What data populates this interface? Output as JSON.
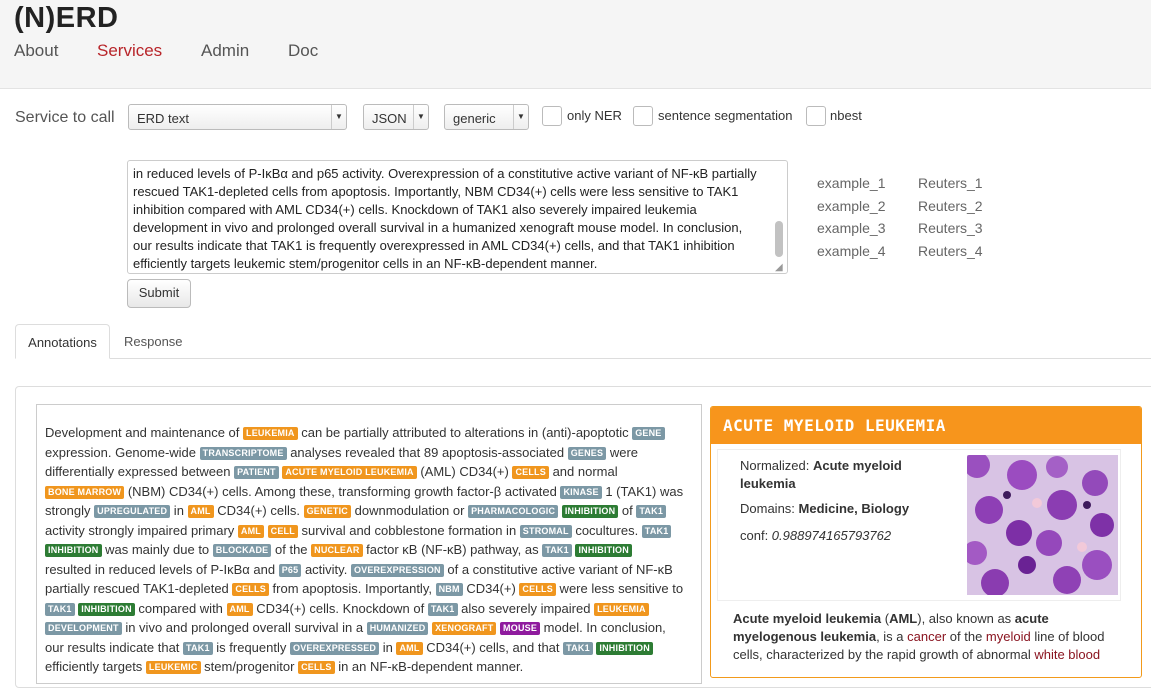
{
  "app": {
    "brand": "(N)ERD"
  },
  "nav": {
    "items": [
      {
        "label": "About"
      },
      {
        "label": "Services",
        "active": true
      },
      {
        "label": "Admin"
      },
      {
        "label": "Doc"
      }
    ]
  },
  "form": {
    "service_label": "Service to call",
    "service_value": "ERD text",
    "format_value": "JSON",
    "customisation_value": "generic",
    "checkboxes": {
      "only_ner": "only NER",
      "sentence_segmentation": "sentence segmentation",
      "nbest": "nbest"
    },
    "text_lines": [
      "in reduced levels of P-IκBα and p65 activity. Overexpression of a constitutive active variant of NF-κB partially",
      "rescued TAK1-depleted cells from apoptosis. Importantly, NBM CD34(+) cells were less sensitive to TAK1",
      "inhibition compared with AML CD34(+) cells. Knockdown of TAK1 also severely impaired leukemia",
      "development in vivo and prolonged overall survival in a humanized xenograft mouse model. In conclusion,",
      "our results indicate that TAK1 is frequently overexpressed in AML CD34(+) cells, and that TAK1 inhibition",
      "efficiently targets leukemic stem/progenitor cells in an NF-κB-dependent manner."
    ],
    "submit_label": "Submit"
  },
  "examples": {
    "col1": [
      "example_1",
      "example_2",
      "example_3",
      "example_4"
    ],
    "col2": [
      "Reuters_1",
      "Reuters_2",
      "Reuters_3",
      "Reuters_4"
    ]
  },
  "tabs": [
    {
      "label": "Annotations",
      "active": true
    },
    {
      "label": "Response"
    }
  ],
  "annotation_lines": [
    [
      [
        "t",
        "Development and maintenance of "
      ],
      [
        "o",
        "LEUKEMIA"
      ],
      [
        "t",
        " can be partially attributed to alterations in (anti)-apoptotic "
      ],
      [
        "g",
        "GENE"
      ]
    ],
    [
      [
        "t",
        "expression. Genome-wide "
      ],
      [
        "g",
        "TRANSCRIPTOME"
      ],
      [
        "t",
        " analyses revealed that 89 apoptosis-associated "
      ],
      [
        "g",
        "GENES"
      ],
      [
        "t",
        " were"
      ]
    ],
    [
      [
        "t",
        "differentially expressed between "
      ],
      [
        "g",
        "PATIENT"
      ],
      [
        "t",
        " "
      ],
      [
        "o",
        "ACUTE MYELOID LEUKEMIA"
      ],
      [
        "t",
        " (AML) CD34(+) "
      ],
      [
        "o",
        "CELLS"
      ],
      [
        "t",
        " and normal"
      ]
    ],
    [
      [
        "o",
        "BONE MARROW"
      ],
      [
        "t",
        " (NBM) CD34(+) cells. Among these, transforming growth factor-β activated "
      ],
      [
        "g",
        "KINASE"
      ],
      [
        "t",
        " 1 (TAK1) was"
      ]
    ],
    [
      [
        "t",
        "strongly "
      ],
      [
        "g",
        "UPREGULATED"
      ],
      [
        "t",
        " in "
      ],
      [
        "o",
        "AML"
      ],
      [
        "t",
        " CD34(+) cells. "
      ],
      [
        "o",
        "GENETIC"
      ],
      [
        "t",
        " downmodulation or "
      ],
      [
        "g",
        "PHARMACOLOGIC"
      ],
      [
        "t",
        " "
      ],
      [
        "dg",
        "INHIBITION"
      ],
      [
        "t",
        " of "
      ],
      [
        "g",
        "TAK1"
      ]
    ],
    [
      [
        "t",
        "activity strongly impaired primary "
      ],
      [
        "o",
        "AML"
      ],
      [
        "t",
        " "
      ],
      [
        "o",
        "CELL"
      ],
      [
        "t",
        " survival and cobblestone formation in "
      ],
      [
        "g",
        "STROMAL"
      ],
      [
        "t",
        " cocultures. "
      ],
      [
        "g",
        "TAK1"
      ]
    ],
    [
      [
        "dg",
        "INHIBITION"
      ],
      [
        "t",
        " was mainly due to "
      ],
      [
        "g",
        "BLOCKADE"
      ],
      [
        "t",
        " of the "
      ],
      [
        "o",
        "NUCLEAR"
      ],
      [
        "t",
        " factor κB (NF-κB) pathway, as "
      ],
      [
        "g",
        "TAK1"
      ],
      [
        "t",
        " "
      ],
      [
        "dg",
        "INHIBITION"
      ]
    ],
    [
      [
        "t",
        "resulted in reduced levels of P-IκBα and "
      ],
      [
        "g",
        "P65"
      ],
      [
        "t",
        " activity. "
      ],
      [
        "g",
        "OVEREXPRESSION"
      ],
      [
        "t",
        " of a constitutive active variant of NF-κB"
      ]
    ],
    [
      [
        "t",
        "partially rescued TAK1-depleted "
      ],
      [
        "o",
        "CELLS"
      ],
      [
        "t",
        " from apoptosis. Importantly, "
      ],
      [
        "g",
        "NBM"
      ],
      [
        "t",
        " CD34(+) "
      ],
      [
        "o",
        "CELLS"
      ],
      [
        "t",
        " were less sensitive to"
      ]
    ],
    [
      [
        "g",
        "TAK1"
      ],
      [
        "t",
        " "
      ],
      [
        "dg",
        "INHIBITION"
      ],
      [
        "t",
        " compared with "
      ],
      [
        "o",
        "AML"
      ],
      [
        "t",
        " CD34(+) cells. Knockdown of "
      ],
      [
        "g",
        "TAK1"
      ],
      [
        "t",
        " also severely impaired "
      ],
      [
        "o",
        "LEUKEMIA"
      ]
    ],
    [
      [
        "g",
        "DEVELOPMENT"
      ],
      [
        "t",
        " in vivo and prolonged overall survival in a "
      ],
      [
        "g",
        "HUMANIZED"
      ],
      [
        "t",
        " "
      ],
      [
        "o",
        "XENOGRAFT"
      ],
      [
        "t",
        " "
      ],
      [
        "p",
        "MOUSE"
      ],
      [
        "t",
        " model. In conclusion,"
      ]
    ],
    [
      [
        "t",
        "our results indicate that "
      ],
      [
        "g",
        "TAK1"
      ],
      [
        "t",
        " is frequently "
      ],
      [
        "g",
        "OVEREXPRESSED"
      ],
      [
        "t",
        " in "
      ],
      [
        "o",
        "AML"
      ],
      [
        "t",
        " CD34(+) cells, and that "
      ],
      [
        "g",
        "TAK1"
      ],
      [
        "t",
        " "
      ],
      [
        "dg",
        "INHIBITION"
      ]
    ],
    [
      [
        "t",
        "efficiently targets "
      ],
      [
        "o",
        "LEUKEMIC"
      ],
      [
        "t",
        " stem/progenitor "
      ],
      [
        "o",
        "CELLS"
      ],
      [
        "t",
        " in an NF-κB-dependent manner."
      ]
    ]
  ],
  "entity": {
    "title": "ACUTE MYELOID LEUKEMIA",
    "normalized_label": "Normalized: ",
    "normalized_line1": "Acute myeloid",
    "normalized_line2": "leukemia",
    "domains_label": "Domains: ",
    "domains_value": "Medicine, Biology",
    "conf_label": "conf: ",
    "conf_value": "0.988974165793762",
    "desc": {
      "l1a": "Acute myeloid leukemia",
      "l1b": " (",
      "l1c": "AML",
      "l1d": "), also known as ",
      "l1e": "acute",
      "l2a": "myelogenous leukemia",
      "l2b": ", is a ",
      "l2c": "cancer",
      "l2d": " of the ",
      "l2e": "myeloid",
      "l2f": " line of blood",
      "l3a": "cells, characterized by the rapid growth of abnormal ",
      "l3b": "white blood"
    }
  },
  "colors": {
    "orange": "#f0961e",
    "grey": "#7c98a5",
    "green": "#2d7c34",
    "purple": "#8f1b9e",
    "active_nav": "#b8252a"
  }
}
